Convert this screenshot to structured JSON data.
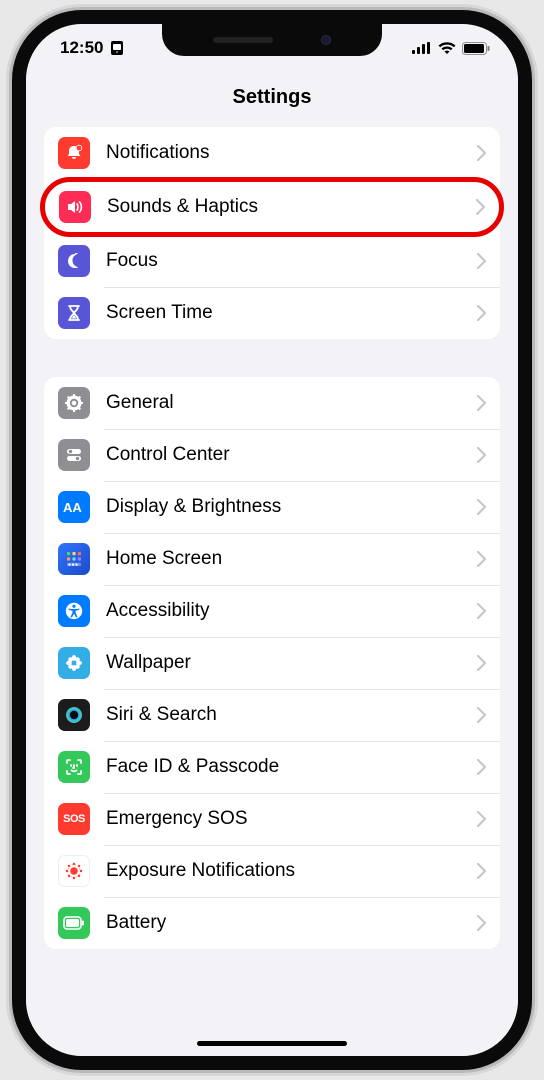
{
  "status": {
    "time": "12:50",
    "orientation_lock": true,
    "signal_bars": 4,
    "wifi": true,
    "battery_glyph": true
  },
  "header": {
    "title": "Settings"
  },
  "groups": [
    {
      "id": "alerts",
      "items": [
        {
          "id": "notifications",
          "label": "Notifications",
          "icon": "bell-badge-icon",
          "color": "c-red",
          "highlighted": false
        },
        {
          "id": "sounds-haptics",
          "label": "Sounds & Haptics",
          "icon": "speaker-wave-icon",
          "color": "c-pink",
          "highlighted": true
        },
        {
          "id": "focus",
          "label": "Focus",
          "icon": "moon-icon",
          "color": "c-indigo",
          "highlighted": false
        },
        {
          "id": "screen-time",
          "label": "Screen Time",
          "icon": "hourglass-icon",
          "color": "c-indigo",
          "highlighted": false
        }
      ]
    },
    {
      "id": "system",
      "items": [
        {
          "id": "general",
          "label": "General",
          "icon": "gear-icon",
          "color": "c-gray",
          "highlighted": false
        },
        {
          "id": "control-center",
          "label": "Control Center",
          "icon": "toggles-icon",
          "color": "c-gray",
          "highlighted": false
        },
        {
          "id": "display",
          "label": "Display & Brightness",
          "icon": "text-size-icon",
          "color": "c-blue",
          "highlighted": false
        },
        {
          "id": "home-screen",
          "label": "Home Screen",
          "icon": "app-grid-icon",
          "color": "c-homescreen",
          "highlighted": false
        },
        {
          "id": "accessibility",
          "label": "Accessibility",
          "icon": "accessibility-icon",
          "color": "c-blue",
          "highlighted": false
        },
        {
          "id": "wallpaper",
          "label": "Wallpaper",
          "icon": "flower-icon",
          "color": "c-cyan",
          "highlighted": false
        },
        {
          "id": "siri",
          "label": "Siri & Search",
          "icon": "siri-icon",
          "color": "c-black",
          "highlighted": false
        },
        {
          "id": "face-id",
          "label": "Face ID & Passcode",
          "icon": "face-id-icon",
          "color": "c-green",
          "highlighted": false
        },
        {
          "id": "sos",
          "label": "Emergency SOS",
          "icon": "sos-icon",
          "color": "c-red",
          "sos_text": "SOS",
          "highlighted": false
        },
        {
          "id": "exposure",
          "label": "Exposure Notifications",
          "icon": "exposure-icon",
          "color": "c-white",
          "highlighted": false
        },
        {
          "id": "battery",
          "label": "Battery",
          "icon": "battery-icon",
          "color": "c-battery",
          "highlighted": false
        }
      ]
    }
  ]
}
